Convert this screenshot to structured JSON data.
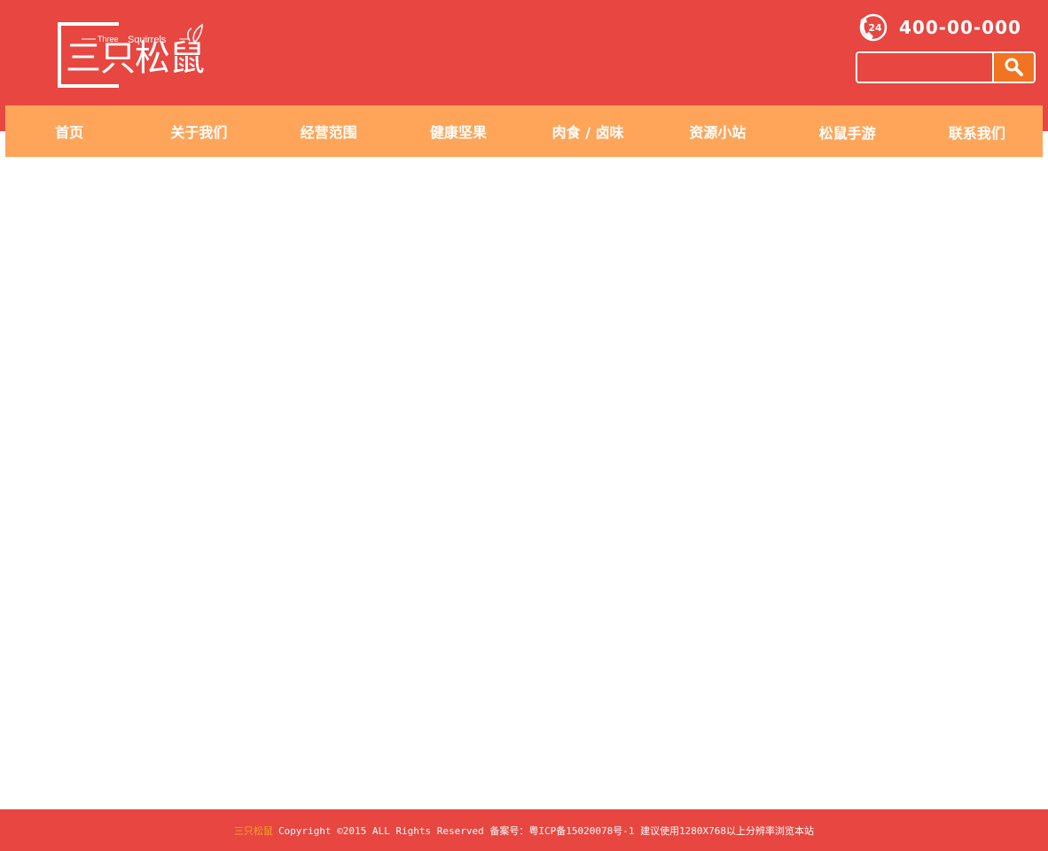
{
  "header": {
    "logo_cn": "三只松鼠",
    "logo_en_1": "Three",
    "logo_en_2": "Squirrels",
    "phone_badge": "24",
    "phone_number": "400-00-000"
  },
  "search": {
    "placeholder": "",
    "value": ""
  },
  "nav": {
    "items": [
      {
        "label": "首页"
      },
      {
        "label": "关于我们"
      },
      {
        "label": "经营范围"
      },
      {
        "label": "健康坚果"
      },
      {
        "label": "肉食 / 卤味"
      },
      {
        "label": "资源小站"
      },
      {
        "label": "松鼠手游"
      },
      {
        "label": "联系我们"
      }
    ]
  },
  "footer": {
    "brand": "三只松鼠",
    "text": "Copyright ©2015 ALL Rights Reserved 备案号：粤ICP备15020078号-1 建议使用1280X768以上分辨率浏览本站"
  },
  "colors": {
    "header_red": "#e84640",
    "nav_orange": "#fea55a",
    "search_button": "#f07421",
    "footer_brand": "#f7a428"
  }
}
